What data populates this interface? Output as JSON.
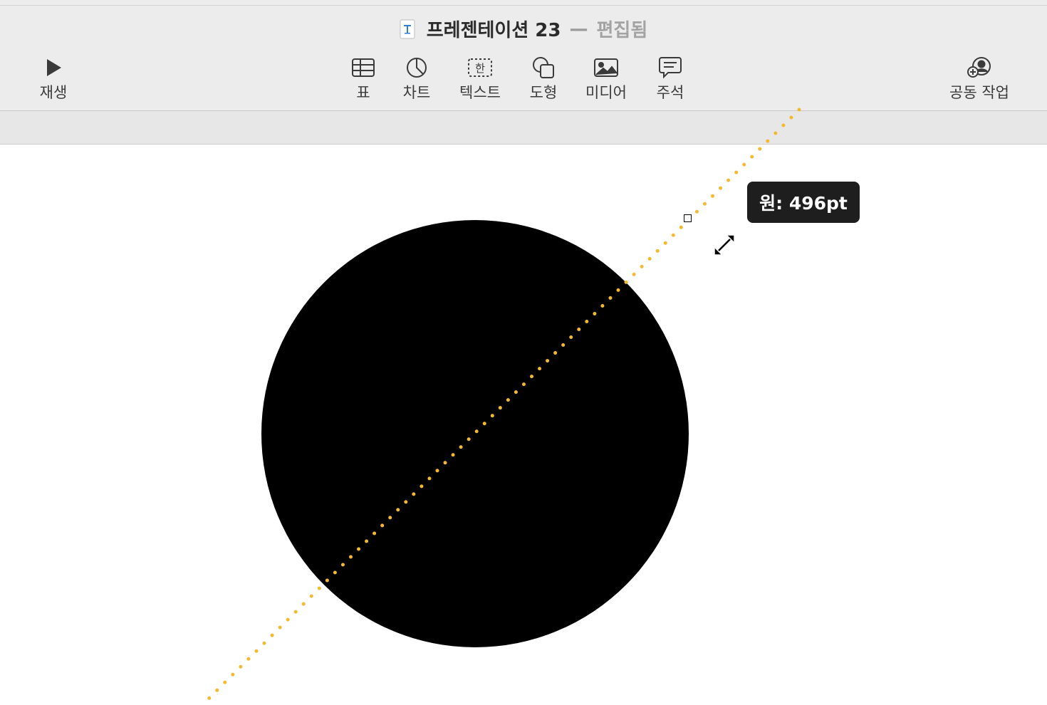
{
  "window": {
    "document_title": "프레젠테이션 23",
    "separator": "—",
    "status": "편집됨"
  },
  "toolbar": {
    "play": {
      "label": "재생",
      "icon": "play-icon"
    },
    "table": {
      "label": "표",
      "icon": "table-icon"
    },
    "chart": {
      "label": "차트",
      "icon": "chart-icon"
    },
    "text": {
      "label": "텍스트",
      "icon": "text-box-icon",
      "glyph": "한"
    },
    "shape": {
      "label": "도형",
      "icon": "shape-icon"
    },
    "media": {
      "label": "미디어",
      "icon": "media-icon"
    },
    "comment": {
      "label": "주석",
      "icon": "comment-icon"
    },
    "collaborate": {
      "label": "공동 작업",
      "icon": "collaborate-icon"
    }
  },
  "canvas": {
    "shape": "circle",
    "shape_color": "#000000",
    "guide_color": "#f5b930",
    "tooltip": "원: 496pt"
  },
  "colors": {
    "toolbar_bg": "#ececec",
    "accent_guide": "#f5b930"
  }
}
